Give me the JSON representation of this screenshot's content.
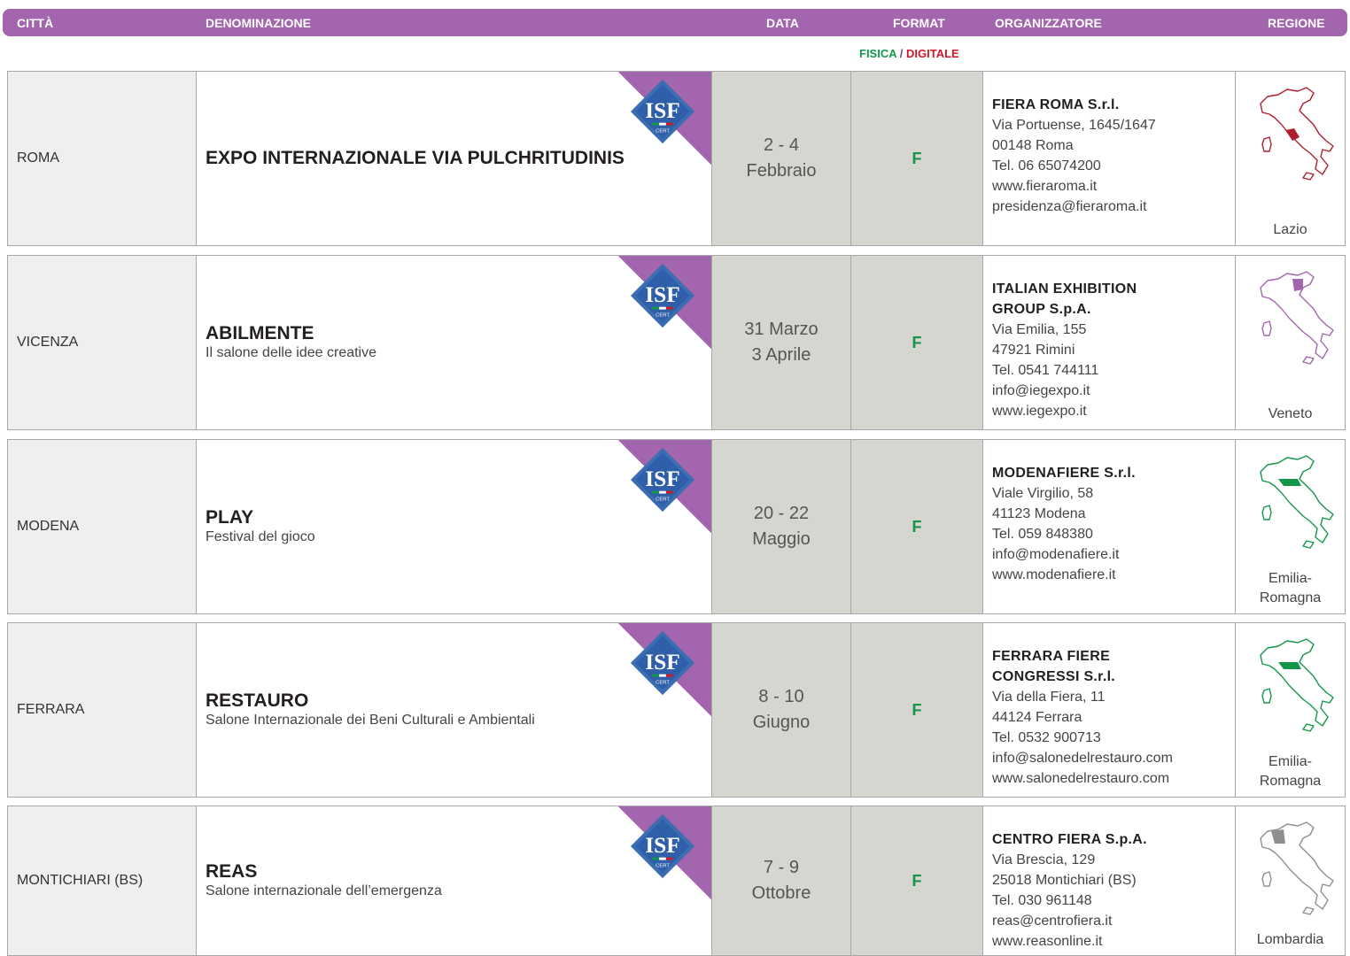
{
  "header": {
    "citta": "CITTÀ",
    "denominazione": "DENOMINAZIONE",
    "data": "DATA",
    "format": "FORMAT",
    "organizzatore": "ORGANIZZATORE",
    "regione": "REGIONE"
  },
  "format_legend": {
    "fisica": "FISICA",
    "sep": "/",
    "digitale": "DIGITALE"
  },
  "badge": {
    "text": "ISF",
    "subtext": "CERT"
  },
  "colors": {
    "header": "#a365ae",
    "fisica": "#14964a",
    "digitale": "#d0192a",
    "date_cell": "#d6d6d1",
    "city_cell": "#efefef"
  },
  "rows": [
    {
      "citta": "ROMA",
      "nome": "EXPO INTERNAZIONALE VIA PULCHRITUDINIS",
      "sottotitolo": "",
      "data_1": "2 - 4",
      "data_2": "Febbraio",
      "format": "F",
      "org_name_1": "FIERA ROMA S.r.l.",
      "org_name_2": "",
      "org_lines": [
        "Via Portuense, 1645/1647",
        "00148 Roma",
        "Tel. 06 65074200",
        "www.fieraroma.it",
        "presidenza@fieraroma.it"
      ],
      "regione": "Lazio",
      "map_color": "#b01e2e"
    },
    {
      "citta": "VICENZA",
      "nome": "ABILMENTE",
      "sottotitolo": "Il salone delle idee creative",
      "data_1": "31 Marzo",
      "data_2": "3 Aprile",
      "format": "F",
      "org_name_1": "ITALIAN EXHIBITION",
      "org_name_2": "GROUP S.p.A.",
      "org_lines": [
        "Via Emilia, 155",
        "47921 Rimini",
        "Tel. 0541 744111",
        "info@iegexpo.it",
        "www.iegexpo.it"
      ],
      "regione": "Veneto",
      "map_color": "#a365ae"
    },
    {
      "citta": "MODENA",
      "nome": "PLAY",
      "sottotitolo": "Festival del gioco",
      "data_1": "20 - 22",
      "data_2": "Maggio",
      "format": "F",
      "org_name_1": "MODENAFIERE S.r.l.",
      "org_name_2": "",
      "org_lines": [
        "Viale Virgilio, 58",
        "41123 Modena",
        "Tel. 059 848380",
        "info@modenafiere.it",
        "www.modenafiere.it"
      ],
      "regione": "Emilia-Romagna",
      "map_color": "#14964a"
    },
    {
      "citta": "FERRARA",
      "nome": "RESTAURO",
      "sottotitolo": "Salone Internazionale dei Beni Culturali e Ambientali",
      "data_1": "8 - 10",
      "data_2": "Giugno",
      "format": "F",
      "org_name_1": "FERRARA FIERE",
      "org_name_2": "CONGRESSI S.r.l.",
      "org_lines": [
        "Via della Fiera, 11",
        "44124 Ferrara",
        "Tel. 0532 900713",
        "info@salonedelrestauro.com",
        "www.salonedelrestauro.com"
      ],
      "regione": "Emilia-Romagna",
      "map_color": "#14964a"
    },
    {
      "citta": "MONTICHIARI (BS)",
      "nome": "REAS",
      "sottotitolo": "Salone internazionale dell’emergenza",
      "data_1": "7 - 9",
      "data_2": "Ottobre",
      "format": "F",
      "org_name_1": "CENTRO FIERA S.p.A.",
      "org_name_2": "",
      "org_lines": [
        "Via Brescia, 129",
        "25018 Montichiari (BS)",
        "Tel. 030 961148",
        "reas@centrofiera.it",
        "www.reasonline.it"
      ],
      "regione": "Lombardia",
      "map_color": "#8e8e8e"
    }
  ]
}
